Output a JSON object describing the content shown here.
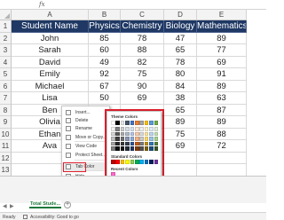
{
  "formula_bar": {
    "fx": "fx"
  },
  "columns": [
    "A",
    "B",
    "C",
    "D",
    "E"
  ],
  "rows": [
    "1",
    "2",
    "3",
    "4",
    "5",
    "6",
    "7",
    "8",
    "9",
    "10",
    "11",
    "12",
    "13"
  ],
  "table": {
    "headers": [
      "Student Name",
      "Physics",
      "Chemistry",
      "Biology",
      "Mathematics"
    ],
    "data": [
      [
        "John",
        "85",
        "78",
        "47",
        "89"
      ],
      [
        "Sarah",
        "60",
        "88",
        "65",
        "77"
      ],
      [
        "David",
        "49",
        "82",
        "78",
        "69"
      ],
      [
        "Emily",
        "92",
        "75",
        "80",
        "91"
      ],
      [
        "Michael",
        "67",
        "90",
        "84",
        "89"
      ],
      [
        "Lisa",
        "50",
        "69",
        "38",
        "63"
      ],
      [
        "Ben",
        "",
        "",
        "65",
        "87"
      ],
      [
        "Olivia",
        "",
        "",
        "89",
        "89"
      ],
      [
        "Ethan",
        "",
        "",
        "75",
        "88"
      ],
      [
        "Ava",
        "",
        "",
        "69",
        "72"
      ]
    ],
    "header_color": "#1f3864"
  },
  "context_menu": {
    "items": [
      "Insert...",
      "Delete",
      "Rename",
      "Move or Copy...",
      "View Code",
      "Protect Sheet...",
      "Tab Color",
      "Hide",
      "Unhide...",
      "Select All Sheets"
    ],
    "highlighted": "Tab Color"
  },
  "color_palette": {
    "theme_label": "Theme Colors",
    "standard_label": "Standard Colors",
    "recent_label": "Recent Colors",
    "no_color": "No Color",
    "more_colors": "More Colors...",
    "theme_top": [
      "#ffffff",
      "#000000",
      "#e7e6e6",
      "#44546a",
      "#4472c4",
      "#ed7d31",
      "#a5a5a5",
      "#ffc000",
      "#5b9bd5",
      "#70ad47"
    ],
    "theme_shades": [
      [
        "#f2f2f2",
        "#7f7f7f",
        "#d0cece",
        "#d6dce4",
        "#d9e2f3",
        "#fbe5d5",
        "#ededed",
        "#fff2cc",
        "#deebf6",
        "#e2efd9"
      ],
      [
        "#d8d8d8",
        "#595959",
        "#aeabab",
        "#adb9ca",
        "#b4c6e7",
        "#f7cbac",
        "#dbdbdb",
        "#fee599",
        "#bdd7ee",
        "#c5e0b3"
      ],
      [
        "#bfbfbf",
        "#3f3f3f",
        "#757070",
        "#8496b0",
        "#8eaadb",
        "#f4b183",
        "#c9c9c9",
        "#ffd965",
        "#9cc3e5",
        "#a8d08d"
      ],
      [
        "#a5a5a5",
        "#262626",
        "#3a3838",
        "#323f4f",
        "#2f5496",
        "#c55a11",
        "#7b7b7b",
        "#bf8f00",
        "#2e75b5",
        "#538135"
      ],
      [
        "#7f7f7f",
        "#0c0c0c",
        "#171616",
        "#222a35",
        "#1e3864",
        "#833c0b",
        "#525252",
        "#7f6000",
        "#1e4e79",
        "#375623"
      ]
    ],
    "standard": [
      "#c00000",
      "#ff0000",
      "#ffc000",
      "#ffff00",
      "#92d050",
      "#00b050",
      "#00b0f0",
      "#0070c0",
      "#002060",
      "#7030a0"
    ],
    "recent": [
      "#ff66cc"
    ]
  },
  "tabs": {
    "active": "Total Stude...",
    "add": "+"
  },
  "status": {
    "ready": "Ready",
    "accessibility": "Accessibility: Good to go"
  }
}
